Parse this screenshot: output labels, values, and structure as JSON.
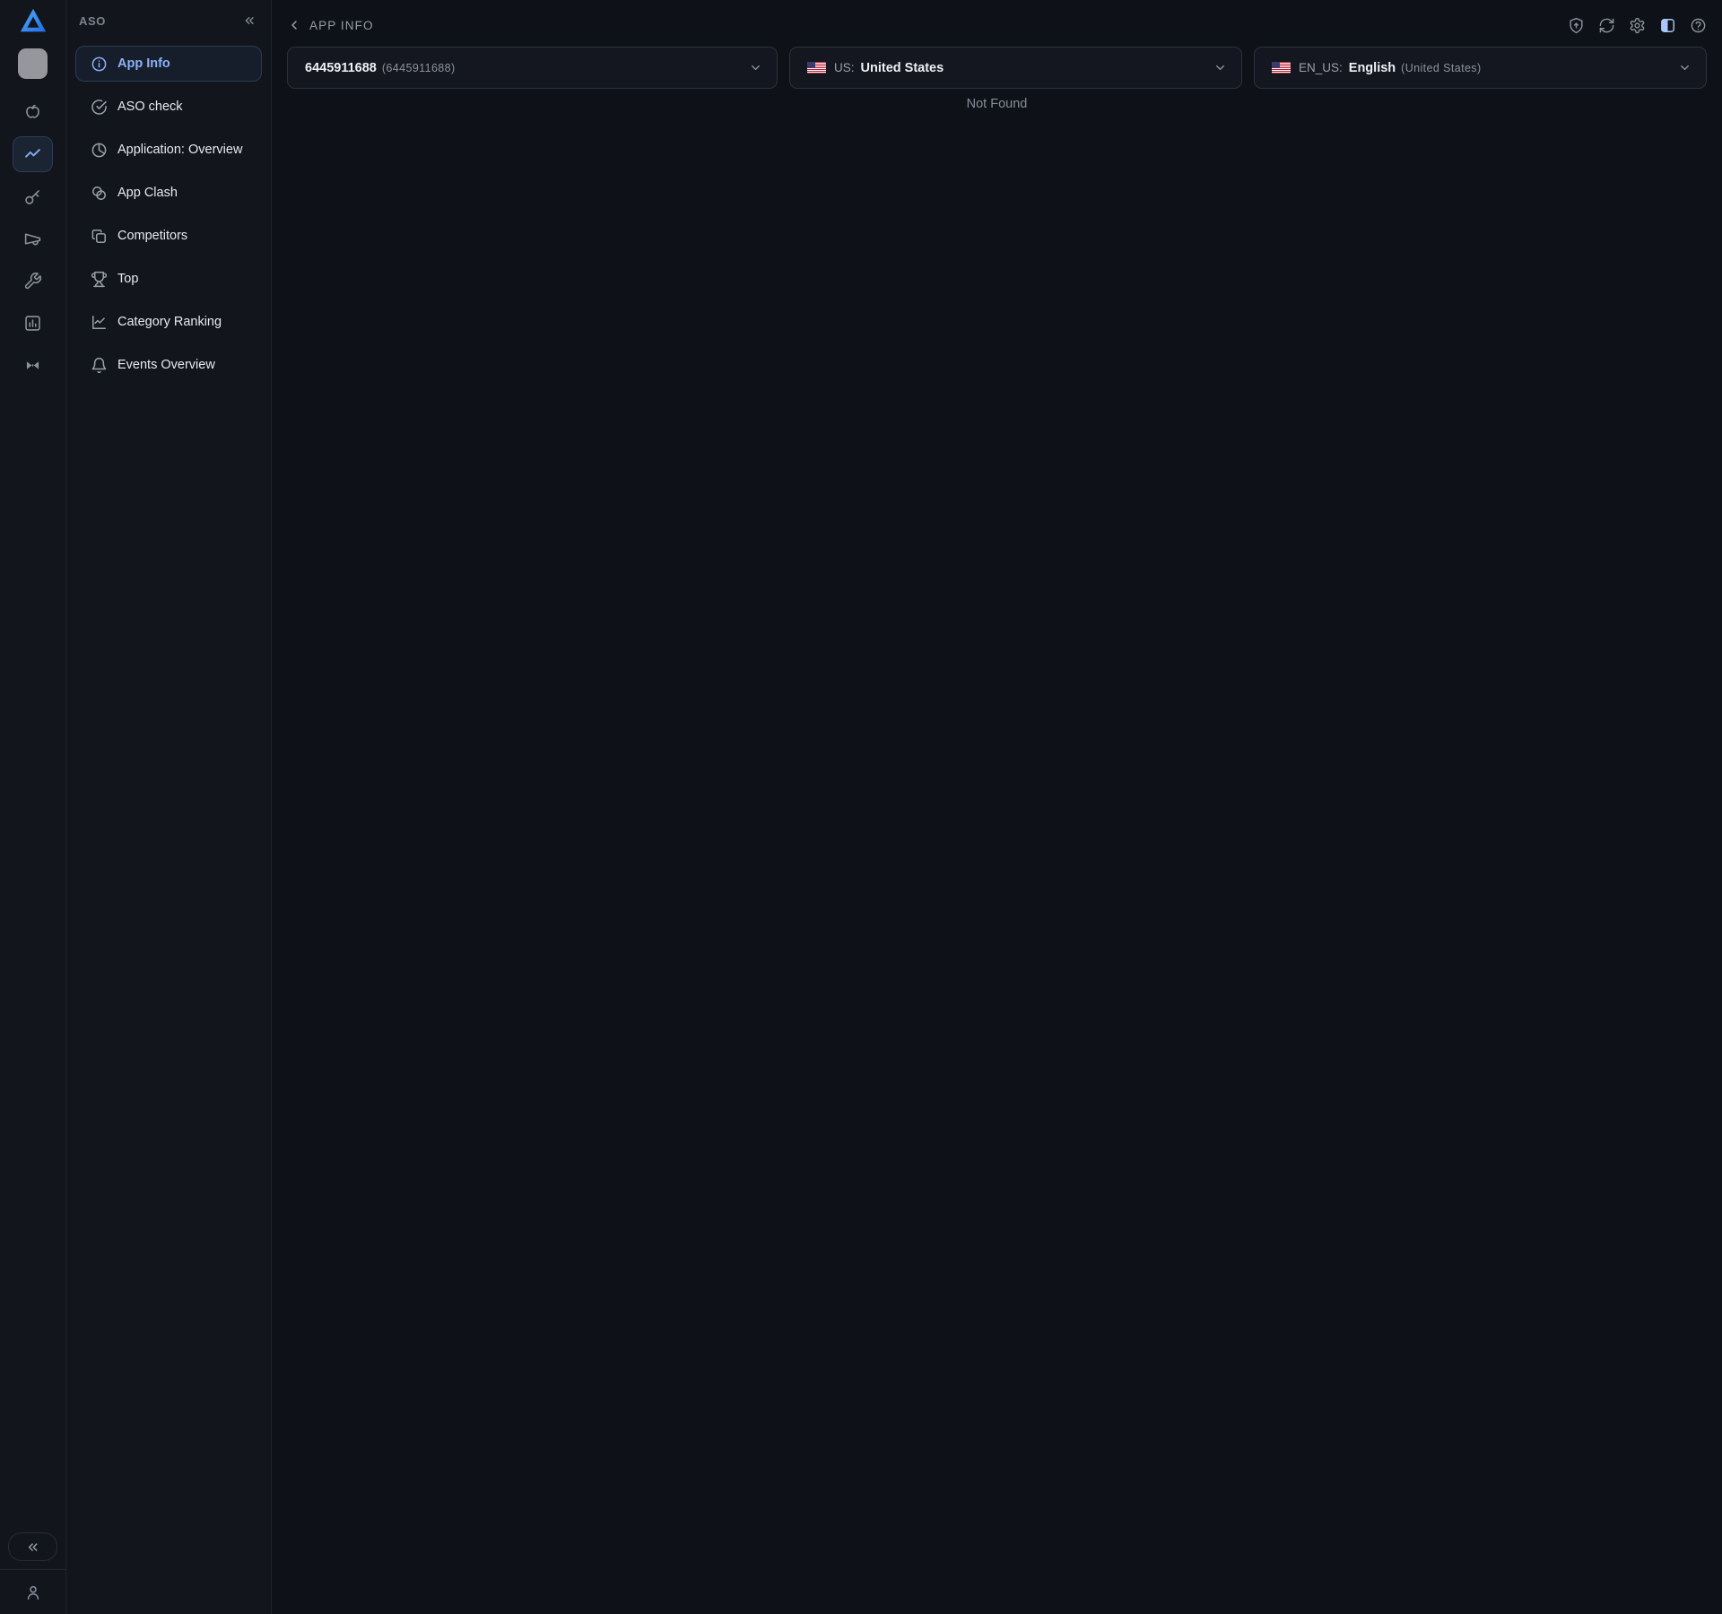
{
  "colors": {
    "accent_blue": "#8cb1f7",
    "panel_toggle_active": "#a9c7fb",
    "logo_blue_light": "#55aaf8",
    "logo_blue_dark": "#1f6de6",
    "flag_red": "#b22234",
    "flag_blue": "#3c3b6e"
  },
  "rail": {
    "icons": [
      {
        "name": "app-placeholder-icon"
      },
      {
        "name": "apple-icon"
      },
      {
        "name": "trending-icon",
        "active": true
      },
      {
        "name": "key-icon"
      },
      {
        "name": "megaphone-icon"
      },
      {
        "name": "wrench-icon"
      },
      {
        "name": "bar-chart-icon"
      },
      {
        "name": "compare-icon"
      }
    ],
    "collapse_glyph": "«",
    "footer_icon": "user-icon"
  },
  "sidebar": {
    "title": "ASO",
    "collapse_glyph": "«",
    "items": [
      {
        "label": "App Info",
        "icon": "info-circle-icon",
        "active": true
      },
      {
        "label": "ASO check",
        "icon": "check-circle-icon",
        "active": false
      },
      {
        "label": "Application: Overview",
        "icon": "pie-chart-icon",
        "active": false
      },
      {
        "label": "App Clash",
        "icon": "overlap-circles-icon",
        "active": false
      },
      {
        "label": "Competitors",
        "icon": "copy-icon",
        "active": false
      },
      {
        "label": "Top",
        "icon": "trophy-icon",
        "active": false
      },
      {
        "label": "Category Ranking",
        "icon": "line-chart-icon",
        "active": false
      },
      {
        "label": "Events Overview",
        "icon": "bell-icon",
        "active": false
      }
    ]
  },
  "header": {
    "breadcrumb": "APP INFO",
    "actions": [
      {
        "name": "shield-icon"
      },
      {
        "name": "refresh-icon"
      },
      {
        "name": "settings-gear-icon"
      },
      {
        "name": "panel-toggle-icon",
        "active": true
      },
      {
        "name": "help-icon"
      }
    ]
  },
  "filters": {
    "app_select": {
      "value": "6445911688",
      "secondary": "(6445911688)",
      "icon": "chevron-down-icon"
    },
    "country_select": {
      "flag": "us-flag-icon",
      "prefix": "US:",
      "value": "United States",
      "icon": "chevron-down-icon"
    },
    "locale_select": {
      "flag": "us-flag-icon",
      "prefix": "EN_US:",
      "value": "English",
      "secondary": "(United States)",
      "icon": "chevron-down-icon"
    }
  },
  "main": {
    "empty_state": "Not Found"
  }
}
